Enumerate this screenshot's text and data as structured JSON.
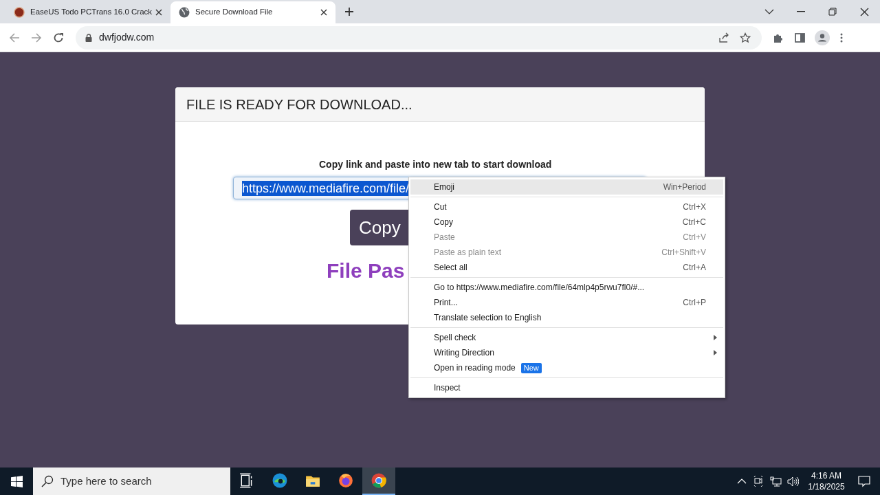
{
  "tabs": [
    {
      "title": "EaseUS Todo PCTrans 16.0 Crack",
      "selected": false
    },
    {
      "title": "Secure Download File",
      "selected": true
    }
  ],
  "address_bar": {
    "url": "dwfjodw.com"
  },
  "card": {
    "heading": "FILE IS READY FOR DOWNLOAD...",
    "instruction": "Copy link and paste into new tab to start download",
    "link_field": {
      "value": "https://www.mediafire.com/file/",
      "selected_text": true
    },
    "copy_button": "Copy",
    "password_label": "File Pas"
  },
  "context_menu": {
    "items": [
      {
        "kind": "item",
        "label": "Emoji",
        "shortcut": "Win+Period",
        "highlighted": true,
        "disabled": false
      },
      {
        "kind": "separator"
      },
      {
        "kind": "item",
        "label": "Cut",
        "shortcut": "Ctrl+X",
        "highlighted": false,
        "disabled": false
      },
      {
        "kind": "item",
        "label": "Copy",
        "shortcut": "Ctrl+C",
        "highlighted": false,
        "disabled": false
      },
      {
        "kind": "item",
        "label": "Paste",
        "shortcut": "Ctrl+V",
        "highlighted": false,
        "disabled": true
      },
      {
        "kind": "item",
        "label": "Paste as plain text",
        "shortcut": "Ctrl+Shift+V",
        "highlighted": false,
        "disabled": true
      },
      {
        "kind": "item",
        "label": "Select all",
        "shortcut": "Ctrl+A",
        "highlighted": false,
        "disabled": false
      },
      {
        "kind": "separator"
      },
      {
        "kind": "item",
        "label": "Go to https://www.mediafire.com/file/64mlp4p5rwu7fl0/#...",
        "highlighted": false,
        "disabled": false
      },
      {
        "kind": "item",
        "label": "Print...",
        "shortcut": "Ctrl+P",
        "highlighted": false,
        "disabled": false
      },
      {
        "kind": "item",
        "label": "Translate selection to English",
        "highlighted": false,
        "disabled": false
      },
      {
        "kind": "separator"
      },
      {
        "kind": "submenu",
        "label": "Spell check",
        "highlighted": false,
        "disabled": false
      },
      {
        "kind": "submenu",
        "label": "Writing Direction",
        "highlighted": false,
        "disabled": false
      },
      {
        "kind": "item",
        "label": "Open in reading mode",
        "badge": "New",
        "highlighted": false,
        "disabled": false
      },
      {
        "kind": "separator"
      },
      {
        "kind": "item",
        "label": "Inspect",
        "highlighted": false,
        "disabled": false
      }
    ]
  },
  "taskbar": {
    "search_placeholder": "Type here to search",
    "apps": [
      {
        "kind": "taskview",
        "active": false
      },
      {
        "kind": "edge",
        "active": false
      },
      {
        "kind": "folder",
        "active": false
      },
      {
        "kind": "firefox",
        "active": false
      },
      {
        "kind": "chrome",
        "active": true
      }
    ],
    "time": "4:16 AM",
    "date": "1/18/2025"
  }
}
